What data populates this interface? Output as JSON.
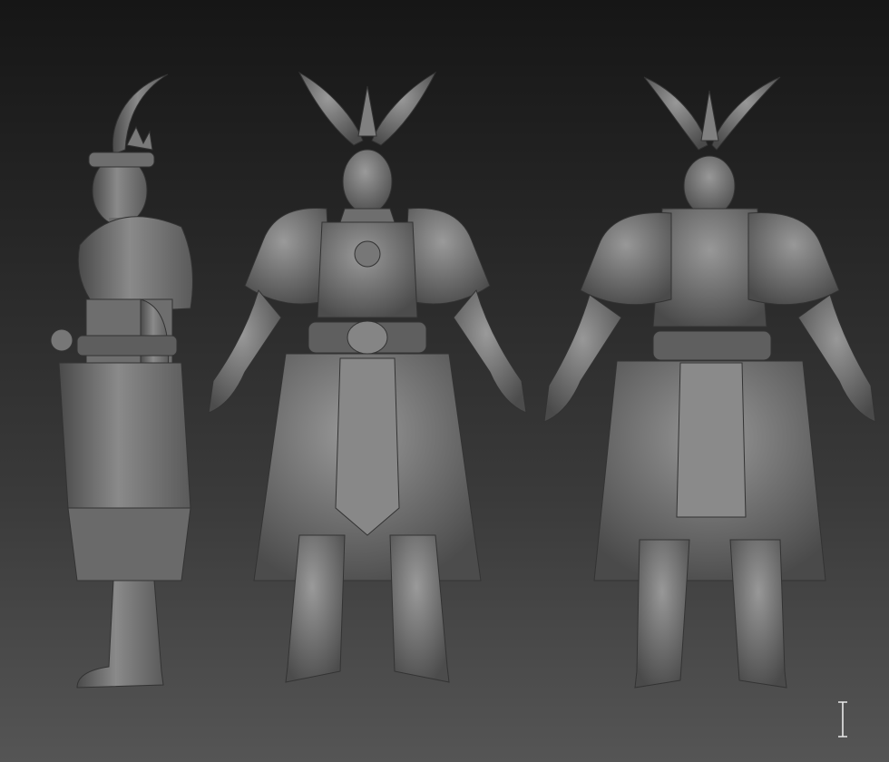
{
  "scene": {
    "background_top": "#161616",
    "background_bottom": "#555555",
    "clay_color": "#7a7a7a",
    "clay_shadow": "#4a4a4a",
    "clay_highlight": "#a6a6a6"
  },
  "views": [
    {
      "id": "side",
      "icon": "sculpt-side-view"
    },
    {
      "id": "front",
      "icon": "sculpt-front-view"
    },
    {
      "id": "back",
      "icon": "sculpt-back-view"
    }
  ],
  "cursor": {
    "icon": "text-cursor-icon"
  }
}
